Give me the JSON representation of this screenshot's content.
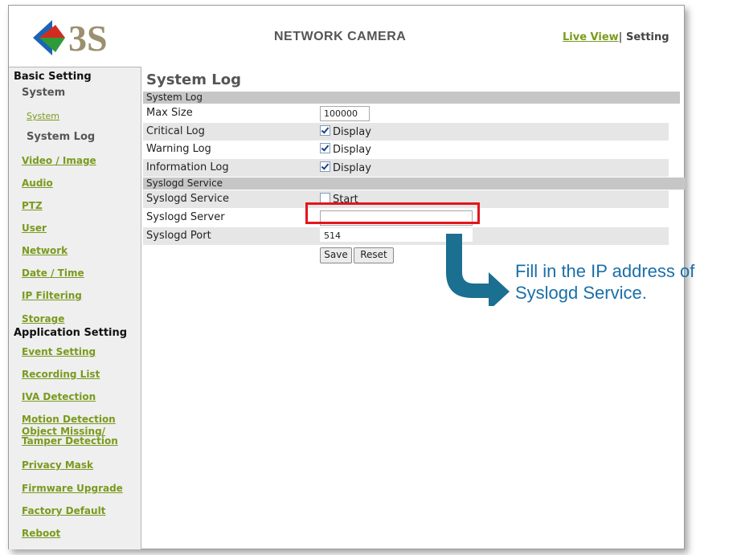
{
  "header": {
    "logo_text": "3S",
    "title": "NETWORK CAMERA",
    "live_view_link": "Live View",
    "separator": "|",
    "setting_label": "Setting"
  },
  "sidebar": {
    "basic_setting": "Basic Setting",
    "system_group": "System",
    "system_link": "System",
    "system_log": "System Log",
    "links_basic": [
      "Video / Image",
      "Audio",
      "PTZ",
      "User",
      "Network",
      "Date / Time",
      "IP Filtering",
      "Storage"
    ],
    "application_setting": "Application Setting",
    "links_app": [
      "Event Setting",
      "Recording List",
      "IVA Detection",
      "Motion Detection",
      "Object Missing/\nTamper Detection",
      "Privacy Mask",
      "Firmware Upgrade",
      "Factory Default",
      "Reboot"
    ]
  },
  "main": {
    "page_title": "System Log",
    "section_system_log": "System Log",
    "max_size_label": "Max Size",
    "max_size_value": "100000",
    "critical_log_label": "Critical Log",
    "warning_log_label": "Warning Log",
    "information_log_label": "Information Log",
    "display_label": "Display",
    "section_syslogd": "Syslogd Service",
    "syslogd_service_label": "Syslogd Service",
    "start_label": "Start",
    "syslogd_server_label": "Syslogd Server",
    "syslogd_server_value": "",
    "syslogd_port_label": "Syslogd Port",
    "syslogd_port_value": "514",
    "save_button": "Save",
    "reset_button": "Reset"
  },
  "checkboxes": {
    "critical_checked": true,
    "warning_checked": true,
    "information_checked": true,
    "start_checked": false
  },
  "callout": {
    "line1": "Fill in the IP address of",
    "line2": "Syslogd Service."
  },
  "colors": {
    "link_green": "#7a9a1e",
    "highlight_red": "#e2161b",
    "callout_blue": "#1a6fa8"
  }
}
